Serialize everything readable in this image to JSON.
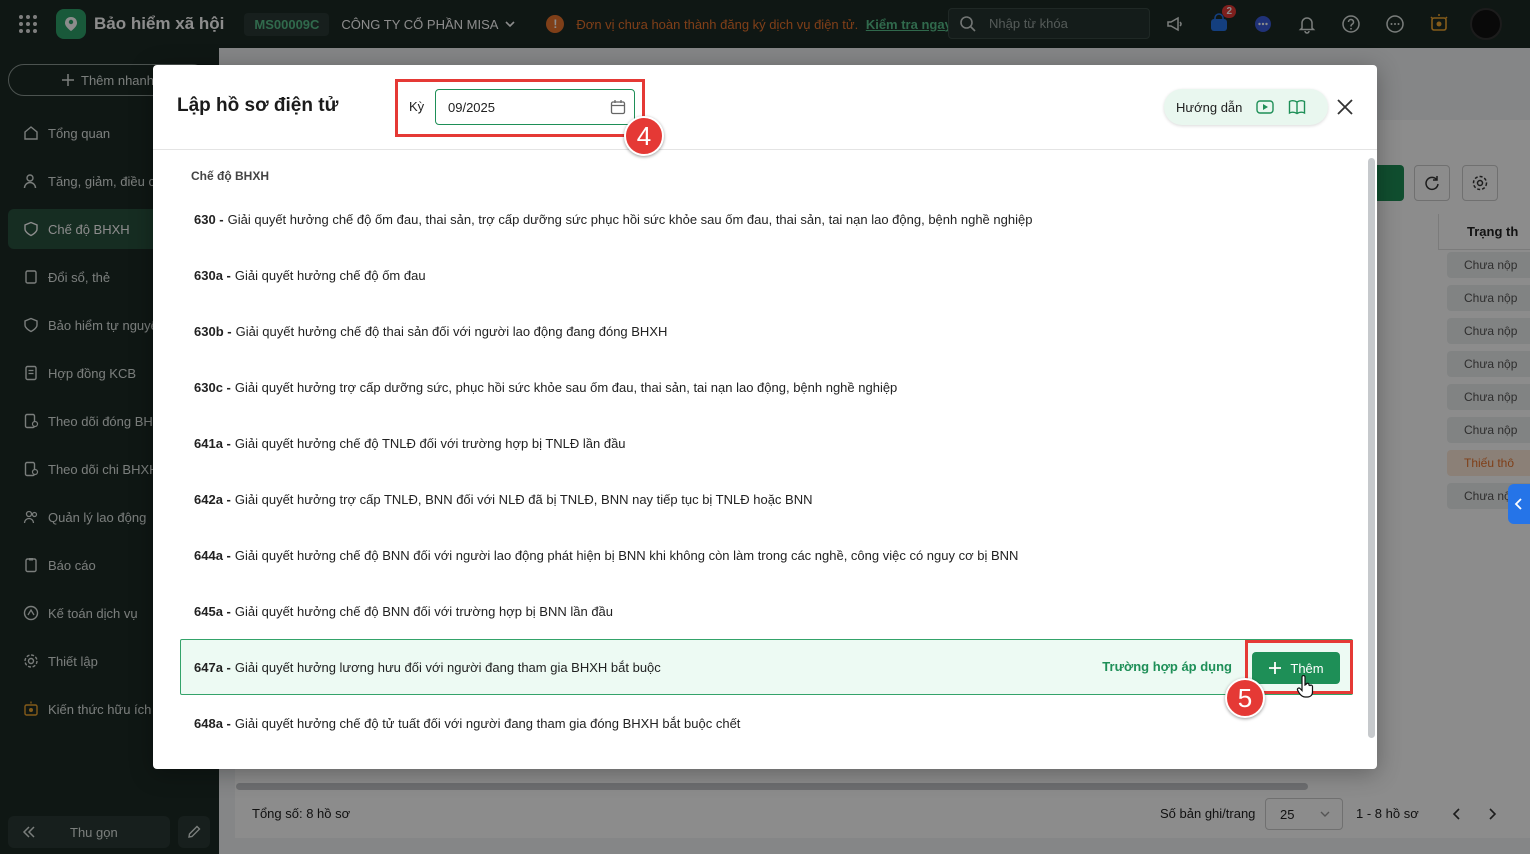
{
  "topbar": {
    "app_title": "Bảo hiểm xã hội",
    "company_code": "MS00009C",
    "company_name": "CÔNG TY CỔ PHẦN MISA",
    "warning_text": "Đơn vị chưa hoàn thành đăng ký dịch vụ điện tử.",
    "warning_link": "Kiểm tra ngay.",
    "search_placeholder": "Nhập từ khóa",
    "cart_count": "2"
  },
  "sidebar": {
    "quick_add": "Thêm nhanh",
    "items": [
      {
        "label": "Tổng quan",
        "icon": "home-icon"
      },
      {
        "label": "Tăng, giảm, điều chỉnh",
        "icon": "user-icon"
      },
      {
        "label": "Chế độ BHXH",
        "icon": "shield-heart-icon"
      },
      {
        "label": "Đổi sổ, thẻ",
        "icon": "card-icon"
      },
      {
        "label": "Bảo hiểm tự nguyện",
        "icon": "shield-icon"
      },
      {
        "label": "Hợp đồng KCB",
        "icon": "document-icon"
      },
      {
        "label": "Theo dõi đóng BHXH",
        "icon": "track-pay-icon"
      },
      {
        "label": "Theo dõi chi BHXH",
        "icon": "track-spend-icon"
      },
      {
        "label": "Quản lý lao động",
        "icon": "people-icon"
      },
      {
        "label": "Báo cáo",
        "icon": "report-icon"
      },
      {
        "label": "Kế toán dịch vụ",
        "icon": "accounting-icon"
      },
      {
        "label": "Thiết lập",
        "icon": "gear-icon"
      },
      {
        "label": "Kiến thức hữu ích",
        "icon": "knowledge-icon"
      }
    ],
    "collapse": "Thu gọn"
  },
  "background": {
    "column_header": "Trạng th",
    "status_rows": [
      "Chưa nộp",
      "Chưa nộp",
      "Chưa nộp",
      "Chưa nộp",
      "Chưa nộp",
      "Chưa nộp",
      "Thiếu thô",
      "Chưa nộ"
    ],
    "total": "Tổng số: 8 hồ sơ",
    "rows_per_page_label": "Số bản ghi/trang",
    "rows_per_page": "25",
    "range": "1 - 8 hồ sơ"
  },
  "modal": {
    "title": "Lập hồ sơ điện tử",
    "period_label": "Kỳ",
    "period_value": "09/2025",
    "guide_label": "Hướng dẫn",
    "section_label": "Chế độ BHXH",
    "regimes": [
      {
        "code": "630 -",
        "desc": "Giải quyết hưởng chế độ ốm đau, thai sản, trợ cấp dưỡng sức phục hồi sức khỏe sau ốm đau, thai sản, tai nạn lao động, bệnh nghề nghiệp"
      },
      {
        "code": "630a -",
        "desc": "Giải quyết hưởng chế độ ốm đau"
      },
      {
        "code": "630b -",
        "desc": "Giải quyết hưởng chế độ thai sản đối với người lao động đang đóng BHXH"
      },
      {
        "code": "630c -",
        "desc": "Giải quyết hưởng trợ cấp dưỡng sức, phục hồi sức khỏe sau ốm đau, thai sản, tai nạn lao động, bệnh nghề nghiệp"
      },
      {
        "code": "641a -",
        "desc": "Giải quyết hưởng chế độ TNLĐ đối với trường hợp bị TNLĐ lần đầu"
      },
      {
        "code": "642a -",
        "desc": "Giải quyết hưởng trợ cấp TNLĐ, BNN đối với NLĐ đã bị TNLĐ, BNN nay tiếp tục bị TNLĐ hoặc BNN"
      },
      {
        "code": "644a -",
        "desc": "Giải quyết hưởng chế độ BNN đối với người lao động phát hiện bị BNN khi không còn làm trong các nghề, công việc có nguy cơ bị BNN"
      },
      {
        "code": "645a -",
        "desc": "Giải quyết hưởng chế độ BNN đối với trường hợp bị BNN lần đầu"
      },
      {
        "code": "647a -",
        "desc": "Giải quyết hưởng lương hưu đối với người đang tham gia BHXH bắt buộc"
      },
      {
        "code": "648a -",
        "desc": "Giải quyết hưởng chế độ tử tuất đối với người đang tham gia đóng BHXH bắt buộc chết"
      }
    ],
    "apply_link": "Trường hợp áp dụng",
    "add_button": "Thêm"
  },
  "annotations": {
    "step_4": "4",
    "step_5": "5"
  },
  "colors": {
    "brand_green": "#1e8f57",
    "highlight_red": "#e53935",
    "warning_orange": "#e8732c"
  }
}
